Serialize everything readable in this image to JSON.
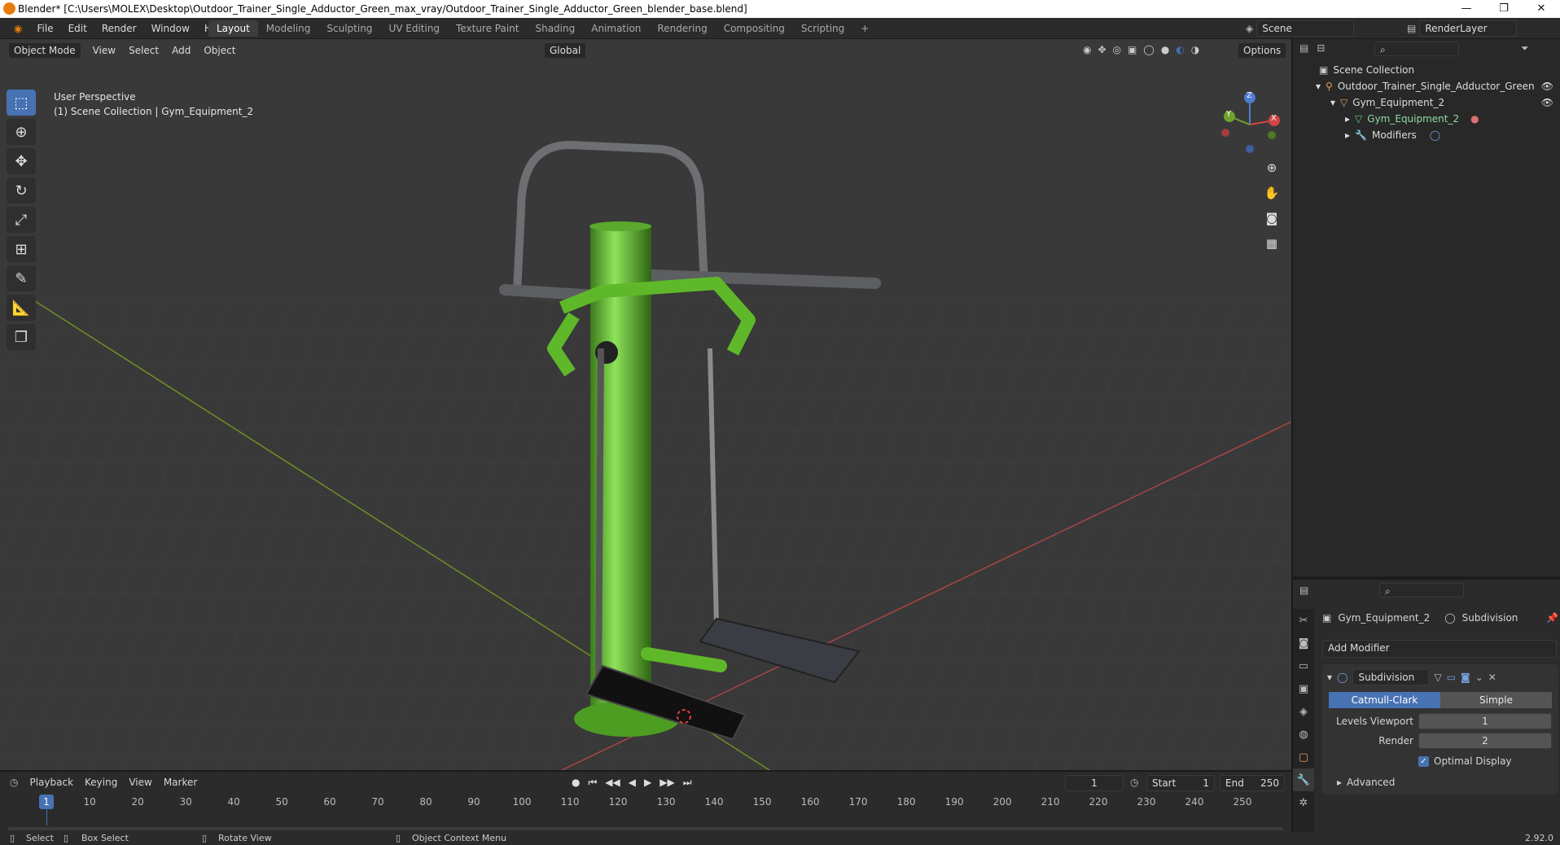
{
  "window": {
    "title": "Blender* [C:\\Users\\MOLEX\\Desktop\\Outdoor_Trainer_Single_Adductor_Green_max_vray/Outdoor_Trainer_Single_Adductor_Green_blender_base.blend]",
    "min": "—",
    "max": "❐",
    "close": "✕"
  },
  "menu": [
    "File",
    "Edit",
    "Render",
    "Window",
    "Help"
  ],
  "workspaces": [
    "Layout",
    "Modeling",
    "Sculpting",
    "UV Editing",
    "Texture Paint",
    "Shading",
    "Animation",
    "Rendering",
    "Compositing",
    "Scripting",
    "+"
  ],
  "scene": {
    "name": "Scene",
    "render_layer": "RenderLayer"
  },
  "viewport_header": {
    "mode": "Object Mode",
    "menus": [
      "View",
      "Select",
      "Add",
      "Object"
    ],
    "transform": "Global",
    "options": "Options"
  },
  "viewport_info": {
    "line1": "User Perspective",
    "line2": "(1) Scene Collection | Gym_Equipment_2"
  },
  "gizmo": {
    "z": "Z",
    "y": "Y",
    "x": "X"
  },
  "outliner": {
    "root": "Scene Collection",
    "items": [
      {
        "label": "Outdoor_Trainer_Single_Adductor_Green"
      },
      {
        "label": "Gym_Equipment_2"
      },
      {
        "label": "Gym_Equipment_2"
      },
      {
        "label": "Modifiers"
      }
    ]
  },
  "properties": {
    "object": "Gym_Equipment_2",
    "modifier_ctx": "Subdivision",
    "add_modifier": "Add Modifier",
    "modifier_name": "Subdivision",
    "mode_a": "Catmull-Clark",
    "mode_b": "Simple",
    "levels_label": "Levels Viewport",
    "levels_value": "1",
    "render_label": "Render",
    "render_value": "2",
    "optimal_label": "Optimal Display",
    "advanced": "Advanced"
  },
  "timeline": {
    "menus": [
      "Playback",
      "Keying",
      "View",
      "Marker"
    ],
    "current": "1",
    "start_label": "Start",
    "start": "1",
    "end_label": "End",
    "end": "250",
    "ticks": [
      "1",
      "10",
      "20",
      "30",
      "40",
      "50",
      "60",
      "70",
      "80",
      "90",
      "100",
      "110",
      "120",
      "130",
      "140",
      "150",
      "160",
      "170",
      "180",
      "190",
      "200",
      "210",
      "220",
      "230",
      "240",
      "250"
    ]
  },
  "status": {
    "select": "Select",
    "box_select": "Box Select",
    "rotate": "Rotate View",
    "context": "Object Context Menu",
    "version": "2.92.0"
  },
  "colors": {
    "accent": "#4772b3",
    "grid_x": "#b84a4a",
    "grid_y": "#7a9a2a",
    "equipment": "#5fb82a"
  }
}
